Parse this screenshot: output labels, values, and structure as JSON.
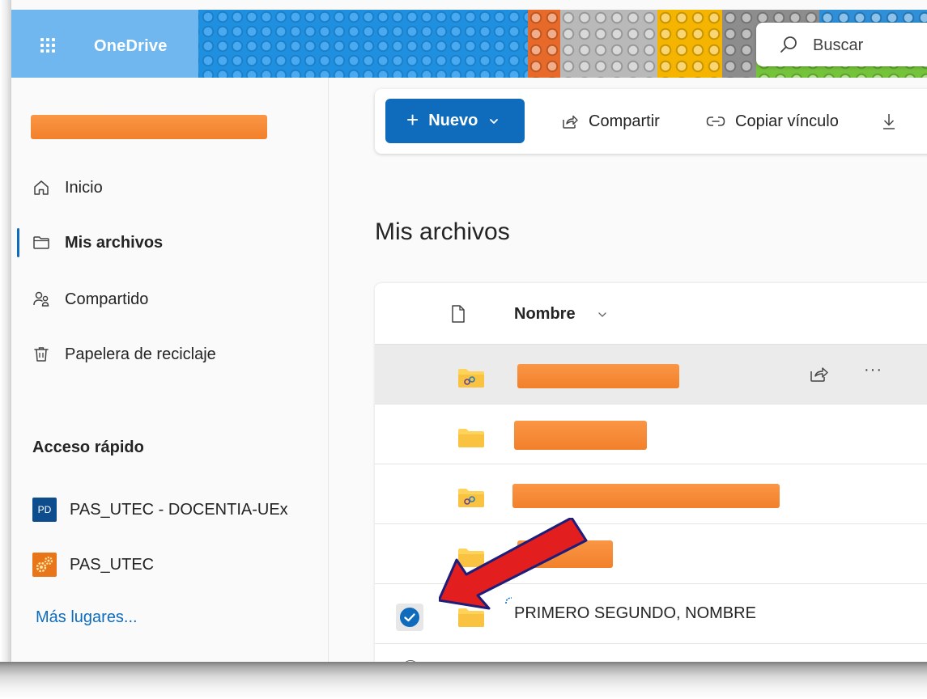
{
  "app": {
    "name": "OneDrive"
  },
  "search": {
    "placeholder": "Buscar"
  },
  "sidebar": {
    "items": [
      {
        "label": "Inicio",
        "icon": "home-icon"
      },
      {
        "label": "Mis archivos",
        "icon": "folder-icon",
        "active": true
      },
      {
        "label": "Compartido",
        "icon": "people-icon"
      },
      {
        "label": "Papelera de reciclaje",
        "icon": "trash-icon"
      }
    ],
    "quick_access_title": "Acceso rápido",
    "quick_access": [
      {
        "badge": "PD",
        "label": "PAS_UTEC - DOCENTIA-UEx"
      },
      {
        "label": "PAS_UTEC",
        "icon": "gears-icon"
      }
    ],
    "more_places": "Más lugares..."
  },
  "toolbar": {
    "new_label": "Nuevo",
    "share_label": "Compartir",
    "copy_link_label": "Copiar vínculo"
  },
  "main": {
    "title": "Mis archivos",
    "list": {
      "name_header": "Nombre",
      "selected_row_name": "PRIMERO SEGUNDO, NOMBRE",
      "more_actions": "···"
    }
  },
  "colors": {
    "accent": "#0f6cbd",
    "redaction": "#f7862f",
    "arrow": "#e21e1e",
    "folder": "#ffd25a"
  }
}
